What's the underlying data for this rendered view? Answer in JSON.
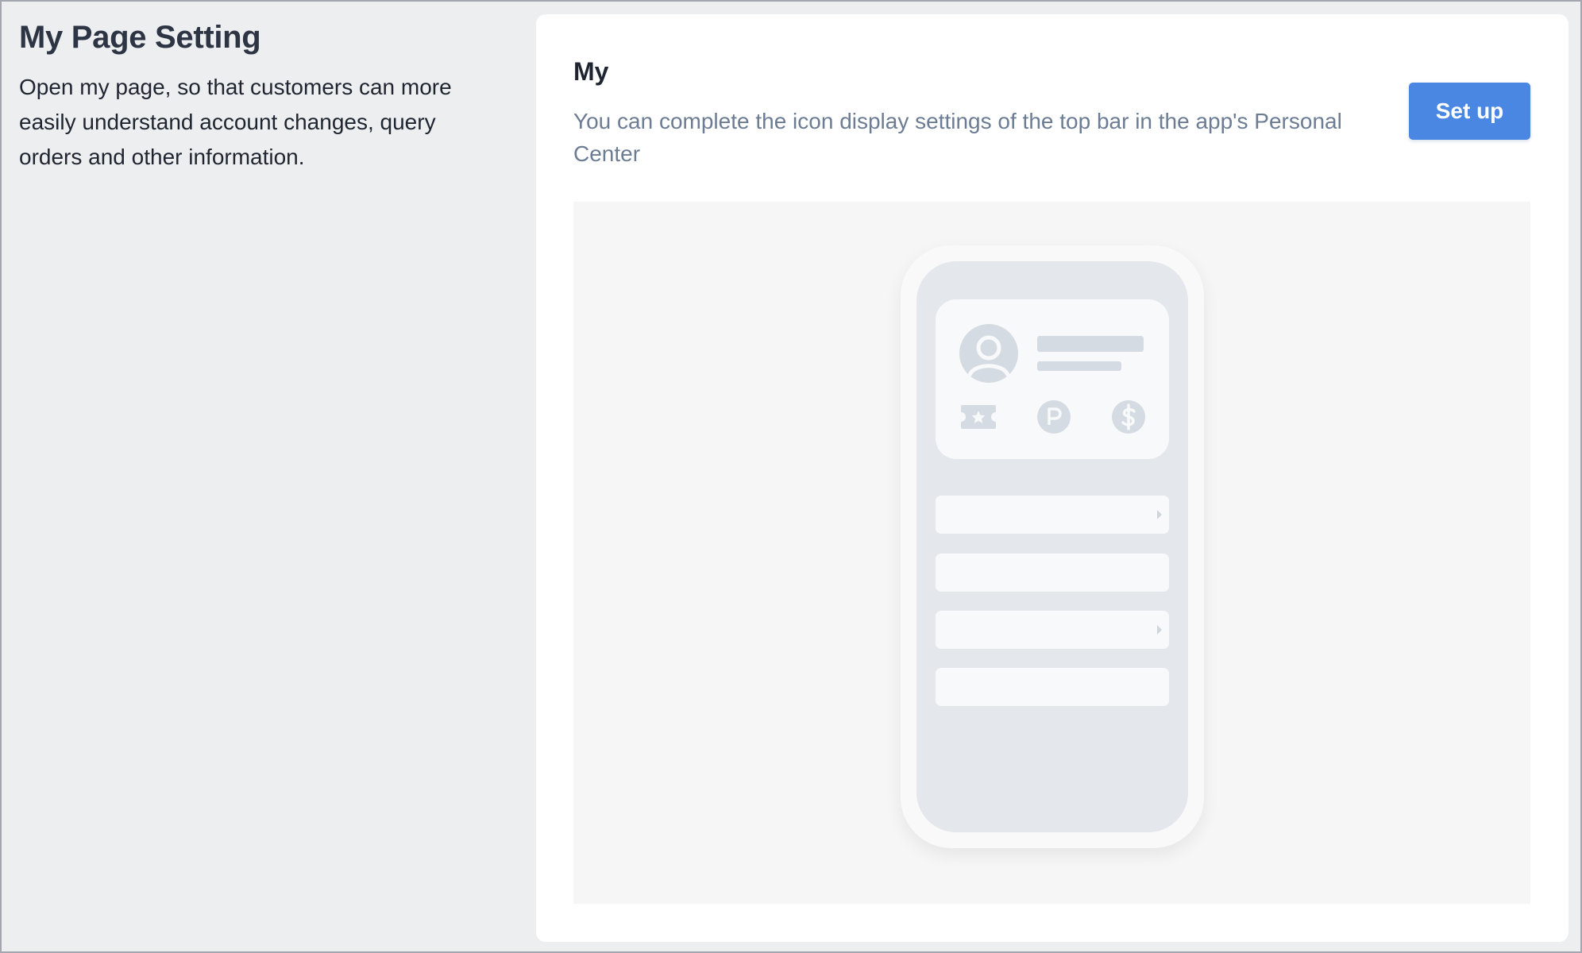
{
  "sidebar": {
    "title": "My Page Setting",
    "description": "Open my page, so that customers can more easily understand account changes, query orders and other information."
  },
  "card": {
    "title": "My",
    "description": "You can complete the icon display settings of the top bar in the app's Personal Center",
    "setup_label": "Set up"
  },
  "preview": {
    "icons": [
      "avatar-icon",
      "coupon-ticket-icon",
      "points-p-icon",
      "dollar-icon",
      "chevron-right-icon"
    ],
    "rows": [
      {
        "has_chevron": true
      },
      {
        "has_chevron": false
      },
      {
        "has_chevron": true
      },
      {
        "has_chevron": false
      }
    ]
  },
  "colors": {
    "accent": "#4a87e3",
    "background": "#edeef0",
    "card": "#ffffff",
    "muted_text": "#6b7c93"
  }
}
